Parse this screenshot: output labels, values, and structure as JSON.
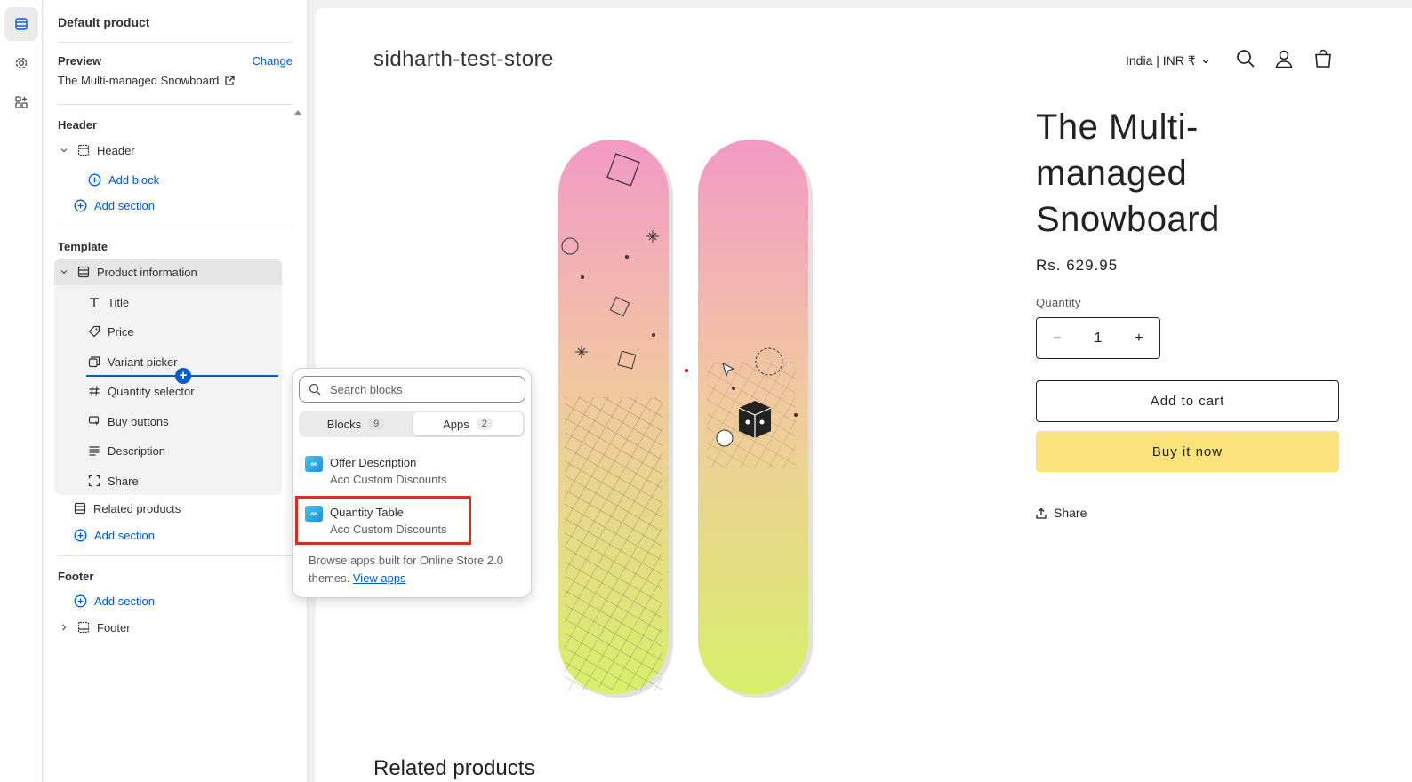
{
  "rail": {
    "items": [
      {
        "icon": "sections-icon",
        "active": true
      },
      {
        "icon": "gear-icon",
        "active": false
      },
      {
        "icon": "apps-icon",
        "active": false
      }
    ]
  },
  "sidebar": {
    "title": "Default product",
    "preview_label": "Preview",
    "change_label": "Change",
    "preview_value": "The Multi-managed Snowboard",
    "header_group": {
      "title": "Header",
      "section": "Header",
      "add_block": "Add block",
      "add_section": "Add section"
    },
    "template_group": {
      "title": "Template",
      "section": "Product information",
      "blocks": [
        {
          "label": "Title",
          "icon": "text-icon"
        },
        {
          "label": "Price",
          "icon": "price-tag-icon"
        },
        {
          "label": "Variant picker",
          "icon": "variant-icon"
        },
        {
          "label": "Quantity selector",
          "icon": "hash-icon"
        },
        {
          "label": "Buy buttons",
          "icon": "cursor-icon"
        },
        {
          "label": "Description",
          "icon": "align-left-icon"
        },
        {
          "label": "Share",
          "icon": "share-frame-icon"
        }
      ],
      "related": "Related products",
      "add_section": "Add section"
    },
    "footer_group": {
      "title": "Footer",
      "add_section": "Add section",
      "section": "Footer"
    }
  },
  "popover": {
    "search_placeholder": "Search blocks",
    "tabs": [
      {
        "label": "Blocks",
        "count": "9",
        "active": false
      },
      {
        "label": "Apps",
        "count": "2",
        "active": true
      }
    ],
    "apps": [
      {
        "name": "Offer Description",
        "vendor": "Aco Custom Discounts"
      },
      {
        "name": "Quantity Table",
        "vendor": "Aco Custom Discounts",
        "highlighted": true
      }
    ],
    "browse_text": "Browse apps built for Online Store 2.0 themes.",
    "view_apps": "View apps"
  },
  "store": {
    "name": "sidharth-test-store",
    "locale": "India | INR ₹",
    "product_title": "The Multi-managed Snowboard",
    "price": "Rs. 629.95",
    "quantity_label": "Quantity",
    "quantity_value": "1",
    "add_to_cart": "Add to cart",
    "buy_now": "Buy it now",
    "share": "Share",
    "related_title": "Related products",
    "colors": {
      "buy_now_bg": "#fbe27a",
      "accent": "#005bd3",
      "highlight": "#d8301c"
    }
  }
}
